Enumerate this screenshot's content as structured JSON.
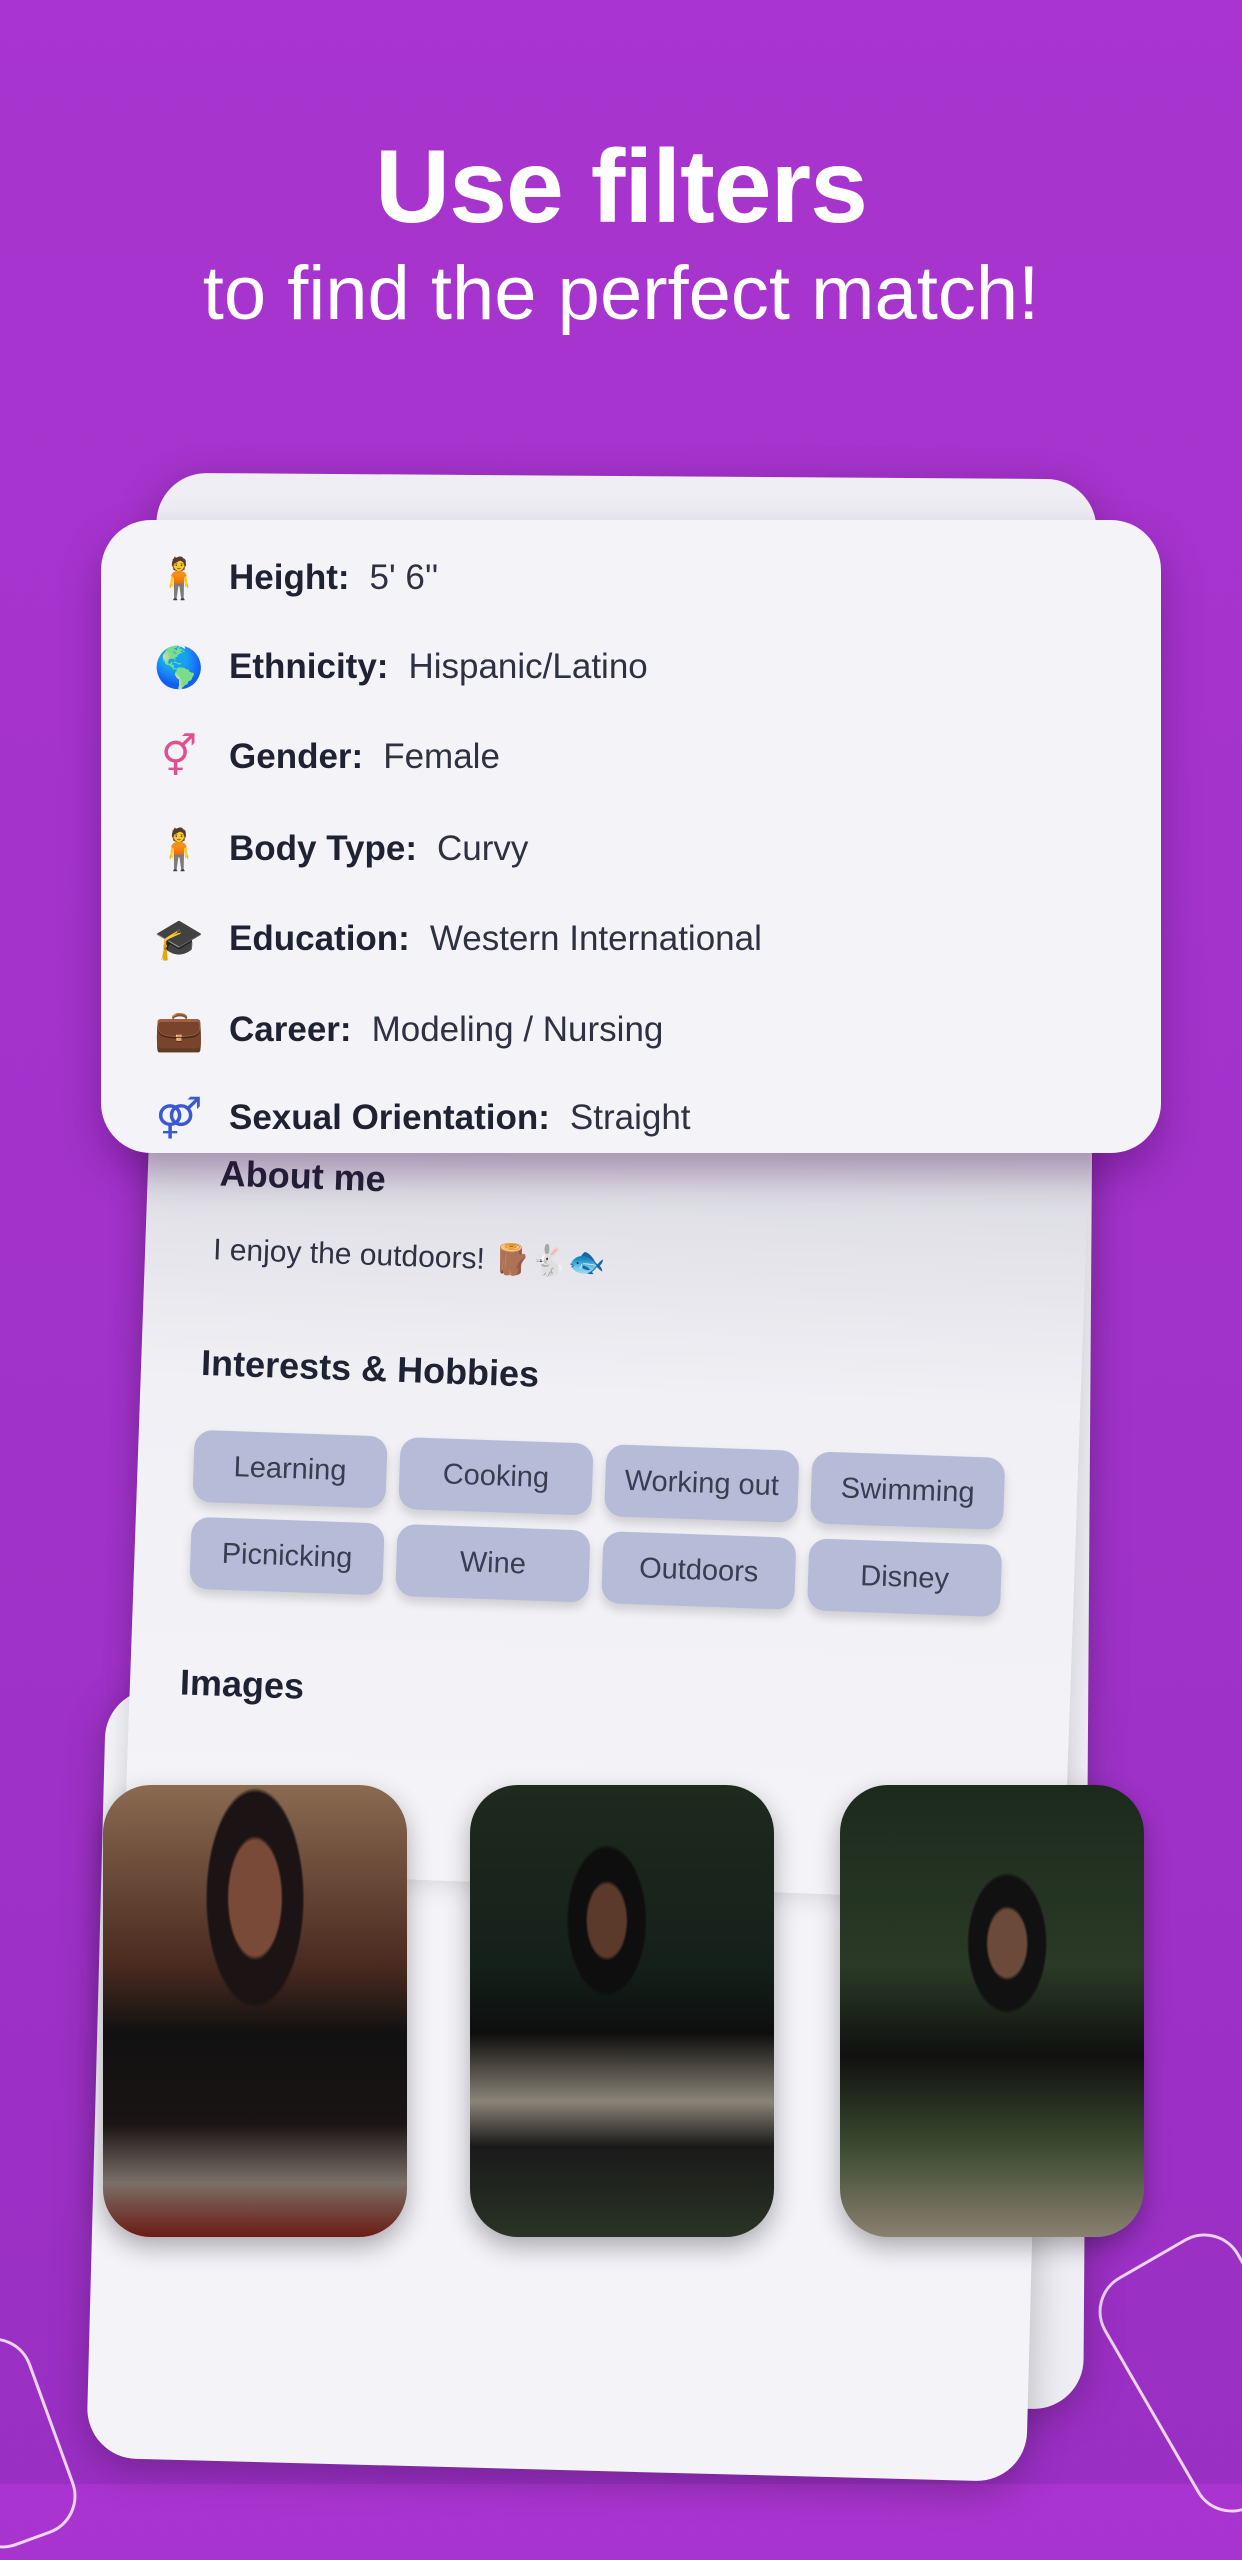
{
  "headline": "Use filters",
  "subheadline": "to find the perfect match!",
  "details": [
    {
      "icon": "height-icon",
      "glyph": "🧍",
      "label": "Height:",
      "value": "5' 6''"
    },
    {
      "icon": "globe-icon",
      "glyph": "🌎",
      "label": "Ethnicity:",
      "value": "Hispanic/Latino"
    },
    {
      "icon": "gender-icon",
      "glyph": "⚥",
      "label": "Gender:",
      "value": "Female"
    },
    {
      "icon": "body-type-icon",
      "glyph": "🧍",
      "label": "Body Type:",
      "value": "Curvy"
    },
    {
      "icon": "graduation-cap-icon",
      "glyph": "🎓",
      "label": "Education:",
      "value": "Western International"
    },
    {
      "icon": "briefcase-icon",
      "glyph": "💼",
      "label": "Career:",
      "value": "Modeling / Nursing"
    },
    {
      "icon": "orientation-icon",
      "glyph": "⚤",
      "label": "Sexual Orientation:",
      "value": "Straight"
    }
  ],
  "about": {
    "title": "About me",
    "text": "I enjoy the outdoors! 🪵🐇🐟"
  },
  "interests": {
    "title": "Interests & Hobbies",
    "items": [
      "Learning",
      "Cooking",
      "Working out",
      "Swimming",
      "Picnicking",
      "Wine",
      "Outdoors",
      "Disney"
    ]
  },
  "images": {
    "title": "Images"
  },
  "colors": {
    "background": "#a934cf",
    "card": "#f3f3f8",
    "chip": "#b6bcd8"
  }
}
